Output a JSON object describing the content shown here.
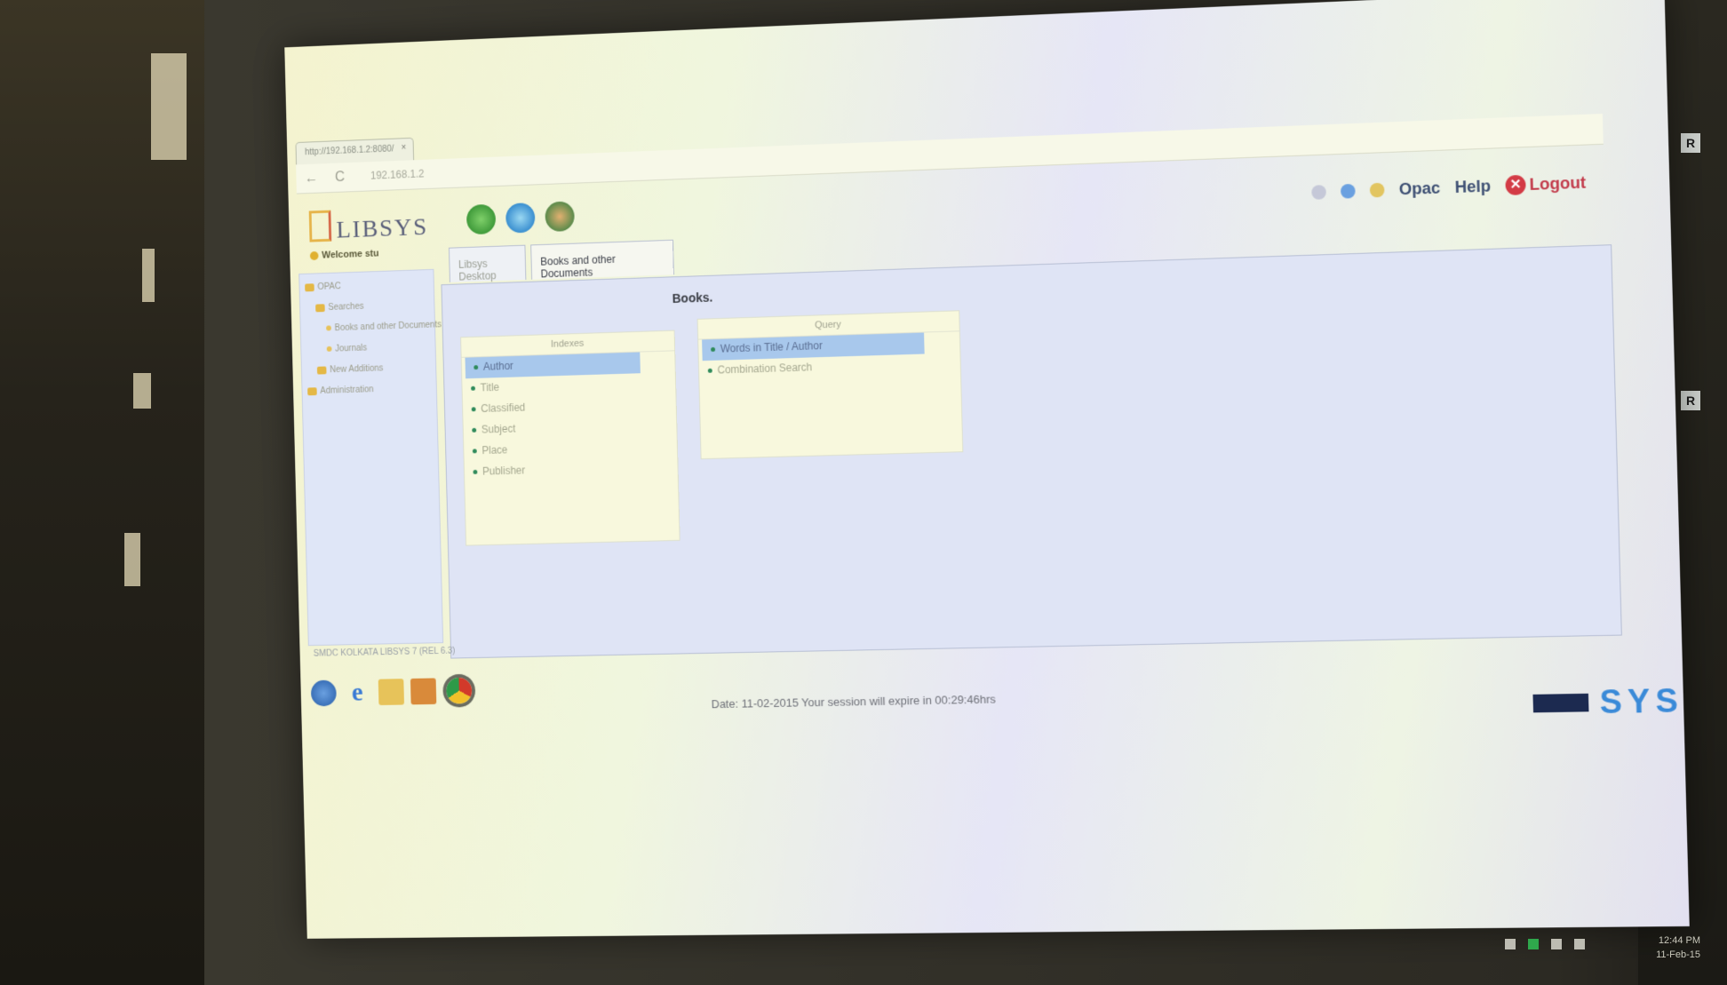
{
  "browser": {
    "tab_title": "http://192.168.1.2:8080/",
    "tab_close": "×",
    "back": "←",
    "reload": "C",
    "url": "192.168.1.2"
  },
  "app": {
    "logo_text": "LIBSYS",
    "welcome": "Welcome stu",
    "top_links": {
      "opac": "Opac",
      "help": "Help",
      "logout": "Logout"
    }
  },
  "sidebar": {
    "items": [
      {
        "label": "OPAC",
        "kind": "folder"
      },
      {
        "label": "Searches",
        "kind": "folder"
      },
      {
        "label": "Books and other Documents",
        "kind": "leaf"
      },
      {
        "label": "Journals",
        "kind": "leaf"
      },
      {
        "label": "New Additions",
        "kind": "folder"
      },
      {
        "label": "Administration",
        "kind": "folder"
      }
    ]
  },
  "tabs": [
    {
      "label": "Libsys Desktop",
      "active": false
    },
    {
      "label": "Books and other Documents",
      "active": true
    }
  ],
  "main": {
    "title": "Books.",
    "indexes": {
      "header": "Indexes",
      "items": [
        {
          "label": "Author",
          "selected": true
        },
        {
          "label": "Title",
          "selected": false
        },
        {
          "label": "Classified",
          "selected": false
        },
        {
          "label": "Subject",
          "selected": false
        },
        {
          "label": "Place",
          "selected": false
        },
        {
          "label": "Publisher",
          "selected": false
        }
      ]
    },
    "query": {
      "header": "Query",
      "items": [
        {
          "label": "Words in Title / Author",
          "selected": true
        },
        {
          "label": "Combination Search",
          "selected": false
        }
      ]
    }
  },
  "footer": {
    "text": "SMDC KOLKATA  LIBSYS 7 (REL 6.3)"
  },
  "status": {
    "text": "Date: 11-02-2015   Your session will expire in 00:29:46hrs"
  },
  "tray": {
    "brand": "SYS"
  },
  "clock": {
    "time": "12:44 PM",
    "date": "11-Feb-15"
  },
  "colors": {
    "selection": "#a8c8ec",
    "logout": "#d33b45",
    "link": "#3d4f73"
  }
}
